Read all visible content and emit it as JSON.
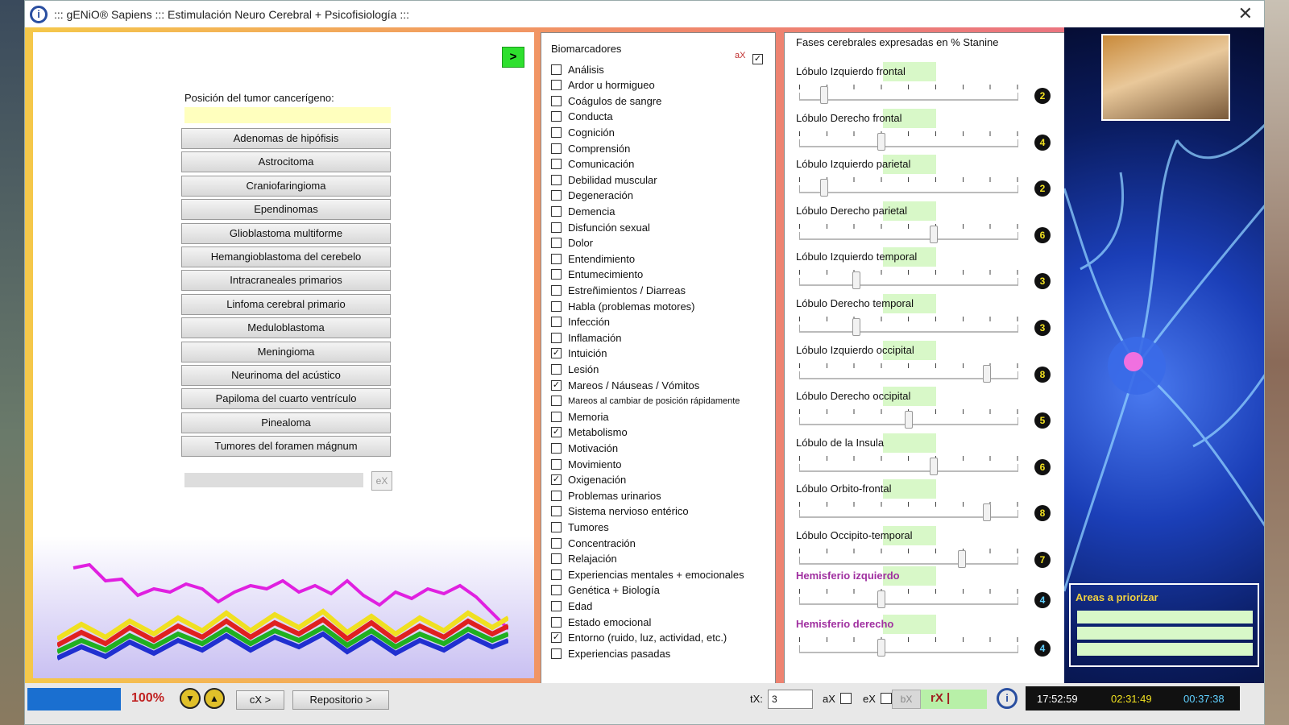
{
  "window": {
    "title": "::: gENiO® Sapiens ::: Estimulación Neuro Cerebral + Psicofisiología :::",
    "close": "✕"
  },
  "left": {
    "go_label": ">",
    "tumor_label": "Posición del tumor cancerígeno:",
    "tumor_value": "",
    "ex_label": "eX",
    "tumors": [
      "Adenomas de hipófisis",
      "Astrocitoma",
      "Craniofaringioma",
      "Ependinomas",
      "Glioblastoma multiforme",
      "Hemangioblastoma del cerebelo",
      "Intracraneales primarios",
      "Linfoma cerebral primario",
      "Meduloblastoma",
      "Meningioma",
      "Neurinoma del acústico",
      "Papiloma del cuarto ventrículo",
      "Pinealoma",
      "Tumores del foramen mágnum"
    ]
  },
  "biomarkers": {
    "title": "Biomarcadores",
    "ax_label": "aX",
    "ax_checked": true,
    "items": [
      {
        "label": "Análisis",
        "checked": false
      },
      {
        "label": "Ardor u hormigueo",
        "checked": false
      },
      {
        "label": "Coágulos de sangre",
        "checked": false
      },
      {
        "label": "Conducta",
        "checked": false
      },
      {
        "label": "Cognición",
        "checked": false
      },
      {
        "label": "Comprensión",
        "checked": false
      },
      {
        "label": "Comunicación",
        "checked": false
      },
      {
        "label": "Debilidad muscular",
        "checked": false
      },
      {
        "label": "Degeneración",
        "checked": false
      },
      {
        "label": "Demencia",
        "checked": false
      },
      {
        "label": "Disfunción sexual",
        "checked": false
      },
      {
        "label": "Dolor",
        "checked": false
      },
      {
        "label": "Entendimiento",
        "checked": false
      },
      {
        "label": "Entumecimiento",
        "checked": false
      },
      {
        "label": "Estreñimientos / Diarreas",
        "checked": false
      },
      {
        "label": "Habla (problemas motores)",
        "checked": false
      },
      {
        "label": "Infección",
        "checked": false
      },
      {
        "label": "Inflamación",
        "checked": false
      },
      {
        "label": "Intuición",
        "checked": true
      },
      {
        "label": "Lesión",
        "checked": false
      },
      {
        "label": "Mareos / Náuseas / Vómitos",
        "checked": true
      },
      {
        "label": "Mareos al cambiar de posición rápidamente",
        "checked": false,
        "small": true
      },
      {
        "label": "Memoria",
        "checked": false
      },
      {
        "label": "Metabolismo",
        "checked": true
      },
      {
        "label": "Motivación",
        "checked": false
      },
      {
        "label": "Movimiento",
        "checked": false
      },
      {
        "label": "Oxigenación",
        "checked": true
      },
      {
        "label": "Problemas urinarios",
        "checked": false
      },
      {
        "label": "Sistema nervioso entérico",
        "checked": false
      },
      {
        "label": "Tumores",
        "checked": false
      },
      {
        "label": "Concentración",
        "checked": false
      },
      {
        "label": "Relajación",
        "checked": false
      },
      {
        "label": "Experiencias mentales + emocionales",
        "checked": false
      },
      {
        "label": "Genética + Biología",
        "checked": false
      },
      {
        "label": "Edad",
        "checked": false
      },
      {
        "label": "Estado emocional",
        "checked": false
      },
      {
        "label": "Entorno (ruido, luz, actividad, etc.)",
        "checked": true
      },
      {
        "label": "Experiencias pasadas",
        "checked": false
      }
    ]
  },
  "phases": {
    "title": "Fases cerebrales expresadas en % Stanine",
    "items": [
      {
        "label": "Lóbulo Izquierdo frontal",
        "value": 2,
        "level": 0.1
      },
      {
        "label": "Lóbulo Derecho frontal",
        "value": 4,
        "level": 0.37
      },
      {
        "label": "Lóbulo Izquierdo parietal",
        "value": 2,
        "level": 0.1
      },
      {
        "label": "Lóbulo Derecho parietal",
        "value": 6,
        "level": 0.62
      },
      {
        "label": "Lóbulo Izquierdo temporal",
        "value": 3,
        "level": 0.25
      },
      {
        "label": "Lóbulo Derecho temporal",
        "value": 3,
        "level": 0.25
      },
      {
        "label": "Lóbulo Izquierdo occipital",
        "value": 8,
        "level": 0.87
      },
      {
        "label": "Lóbulo Derecho occipital",
        "value": 5,
        "level": 0.5
      },
      {
        "label": "Lóbulo de la Insula",
        "value": 6,
        "level": 0.62
      },
      {
        "label": "Lóbulo Orbito-frontal",
        "value": 8,
        "level": 0.87
      },
      {
        "label": "Lóbulo Occipito-temporal",
        "value": 7,
        "level": 0.75
      }
    ],
    "hemis": [
      {
        "label": "Hemisferio izquierdo",
        "value": 4,
        "level": 0.37
      },
      {
        "label": "Hemisferio derecho",
        "value": 4,
        "level": 0.37
      }
    ]
  },
  "right": {
    "areas_title": "Areas a priorizar"
  },
  "status": {
    "zoom": "100%",
    "cx_label": "cX >",
    "repo_label": "Repositorio >",
    "tx_label": "tX:",
    "tx_value": "3",
    "ax_label": "aX",
    "ex_label": "eX",
    "bx_label": "bX",
    "rx_label": "rX |",
    "time1": "17:52:59",
    "time2": "02:31:49",
    "time3": "00:37:38"
  },
  "colors": {
    "accent_green": "#2ee02e",
    "highlight": "#d8f8c8",
    "tumor_field": "#ffffbe",
    "hemi": "#a030a0"
  }
}
